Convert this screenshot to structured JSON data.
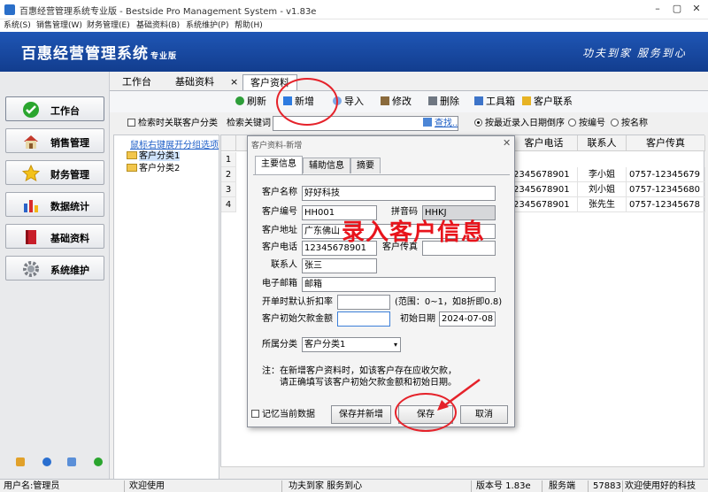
{
  "window": {
    "title": "百惠经营管理系统专业版 - Bestside Pro Management System - v1.83e",
    "min_icon": "minimize-icon",
    "max_icon": "maximize-icon",
    "close_icon": "close-icon"
  },
  "menu": [
    "系统(S)",
    "销售管理(W)",
    "财务管理(E)",
    "基础资料(B)",
    "系统维护(P)",
    "帮助(H)"
  ],
  "banner": {
    "brand": "百惠经营管理系统",
    "edition": "专业版",
    "slogan": "功夫到家 服务到心"
  },
  "nav": [
    {
      "label": "工作台",
      "icon": "check-icon"
    },
    {
      "label": "销售管理",
      "icon": "house-icon"
    },
    {
      "label": "财务管理",
      "icon": "star-icon"
    },
    {
      "label": "数据统计",
      "icon": "bar-chart-icon"
    },
    {
      "label": "基础资料",
      "icon": "book-icon"
    },
    {
      "label": "系统维护",
      "icon": "gear-icon"
    }
  ],
  "tabs": [
    "工作台",
    "基础资料",
    "客户资料"
  ],
  "tab_close": "×",
  "toolbar": [
    "刷新",
    "新增",
    "导入",
    "修改",
    "删除",
    "工具箱",
    "客户联系"
  ],
  "search": {
    "link_checkbox": "检索时关联客户分类",
    "keyword_label": "检索关键词",
    "find_button": "查找..",
    "radio_recent": "按最近录入日期倒序",
    "radio_code": "按编号",
    "radio_name": "按名称"
  },
  "tree": {
    "hint": "鼠标右键展开分组选项",
    "nodes": [
      "客户分类1",
      "客户分类2"
    ]
  },
  "grid": {
    "headers": [
      "客户电话",
      "联系人",
      "客户传真"
    ],
    "row_numbers": [
      "1",
      "2",
      "3",
      "4"
    ],
    "rows": [
      [
        "",
        "",
        ""
      ],
      [
        "2345678901",
        "李小姐",
        "0757-12345679"
      ],
      [
        "2345678901",
        "刘小姐",
        "0757-12345680"
      ],
      [
        "2345678901",
        "张先生",
        "0757-12345678"
      ]
    ]
  },
  "dialog": {
    "title": "客户资料-新增",
    "tabs": [
      "主要信息",
      "辅助信息",
      "摘要"
    ],
    "fields": {
      "name_label": "客户名称",
      "name_value": "好好科技",
      "code_label": "客户编号",
      "code_value": "HH001",
      "pinyin_label": "拼音码",
      "pinyin_value": "HHKJ",
      "address_label": "客户地址",
      "address_value": "广东佛山",
      "phone_label": "客户电话",
      "phone_value": "12345678901",
      "fax_label": "客户传真",
      "fax_value": "",
      "contact_label": "联系人",
      "contact_value": "张三",
      "email_label": "电子邮箱",
      "email_value": "邮箱",
      "discount_label": "开单时默认折扣率",
      "discount_value": "",
      "discount_hint": "(范围：0~1，如8折即0.8)",
      "debt_label": "客户初始欠款金额",
      "debt_value": "",
      "date_label": "初始日期",
      "date_value": "2024-07-08",
      "category_label": "所属分类",
      "category_value": "客户分类1"
    },
    "note_line1": "注：在新增客户资料时，如该客户存在应收欠款，",
    "note_line2": "请正确填写该客户初始欠款金额和初始日期。",
    "remember_label": "记忆当前数据",
    "btn_save_new": "保存并新增",
    "btn_save": "保存",
    "btn_cancel": "取消"
  },
  "annotation": "录入客户信息",
  "status": {
    "user": "用户名:管理员",
    "welcome": "欢迎使用",
    "slogan": "功夫到家 服务到心",
    "version": "版本号 1.83e",
    "service_label": "服务端",
    "service_value": "57883",
    "tail": "欢迎使用好的科技"
  },
  "colors": {
    "banner": "#1a4ea6",
    "annotation_red": "#e5222a"
  }
}
